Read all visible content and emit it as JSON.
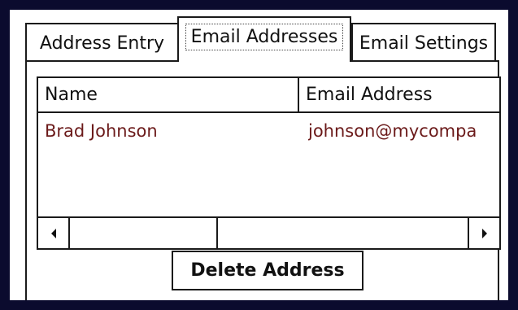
{
  "tabs": [
    {
      "label": "Address Entry",
      "selected": false
    },
    {
      "label": "Email Addresses",
      "selected": true
    },
    {
      "label": "Email Settings",
      "selected": false
    }
  ],
  "list": {
    "columns": [
      "Name",
      "Email Address"
    ],
    "rows": [
      [
        "Brad Johnson",
        "johnson@mycompa"
      ]
    ]
  },
  "scrollbar": {
    "left_icon": "arrow-left-icon",
    "right_icon": "arrow-right-icon"
  },
  "actions": {
    "delete_label": "Delete Address"
  },
  "colors": {
    "frame": "#0b0b2e",
    "border": "#1a1a1a",
    "row_text": "#6b1a1a"
  }
}
